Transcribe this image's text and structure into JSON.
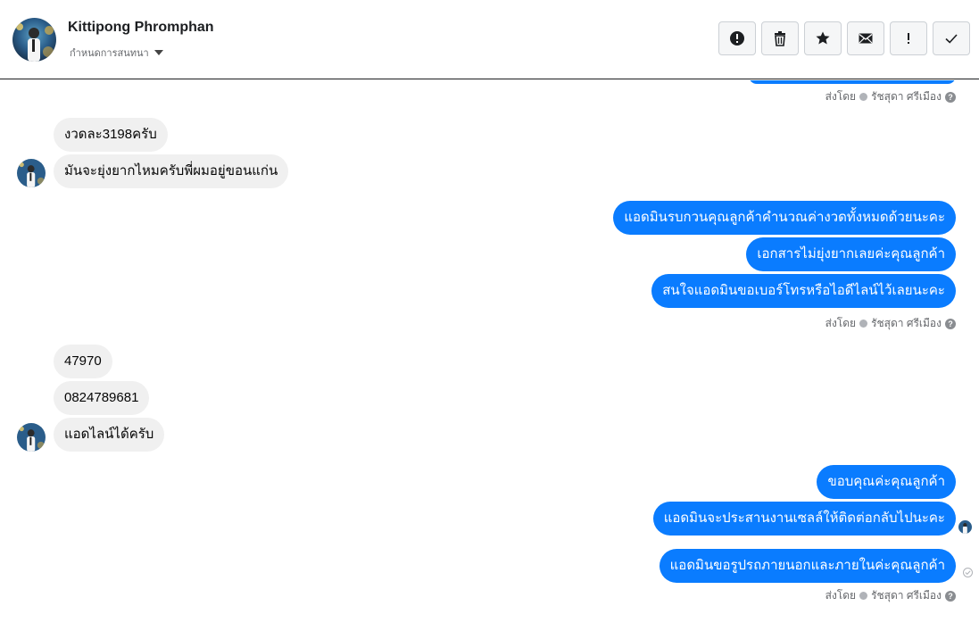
{
  "header": {
    "contact_name": "Kittipong Phromphan",
    "subtitle": "กำหนดการสนทนา",
    "avatar_icon": "profile-photo-icon",
    "toolbar": [
      {
        "name": "report-spam-button",
        "icon": "alert-circle-icon"
      },
      {
        "name": "delete-button",
        "icon": "trash-icon"
      },
      {
        "name": "star-button",
        "icon": "star-icon"
      },
      {
        "name": "mark-unread-button",
        "icon": "envelope-icon"
      },
      {
        "name": "important-button",
        "icon": "exclamation-icon"
      },
      {
        "name": "done-button",
        "icon": "checkmark-icon"
      }
    ]
  },
  "colors": {
    "outgoing_bubble": "#0a7cff",
    "incoming_bubble": "#f0f0f0"
  },
  "messages": {
    "sent_by_label": "ส่งโดย",
    "sender": "รัชสุดา ศรีเมือง",
    "group1": [
      "งวดละ3198ครับ",
      "มันจะยุ่งยากไหมครับพี่ผมอยู่ขอนแก่น"
    ],
    "group2": [
      "แอดมินรบกวนคุณลูกค้าคำนวณค่างวดทั้งหมดด้วยนะคะ",
      "เอกสารไม่ยุ่งยากเลยค่ะคุณลูกค้า",
      "สนใจแอดมินขอเบอร์โทรหรือไอดีไลน์ไว้เลยนะคะ"
    ],
    "group3": [
      "47970",
      "0824789681",
      "แอดไลน์ได้ครับ"
    ],
    "group4": [
      "ขอบคุณค่ะคุณลูกค้า",
      "แอดมินจะประสานงานเซลล์ให้ติดต่อกลับไปนะคะ"
    ],
    "group5": [
      "แอดมินขอรูปรถภายนอกและภายในค่ะคุณลูกค้า"
    ]
  }
}
